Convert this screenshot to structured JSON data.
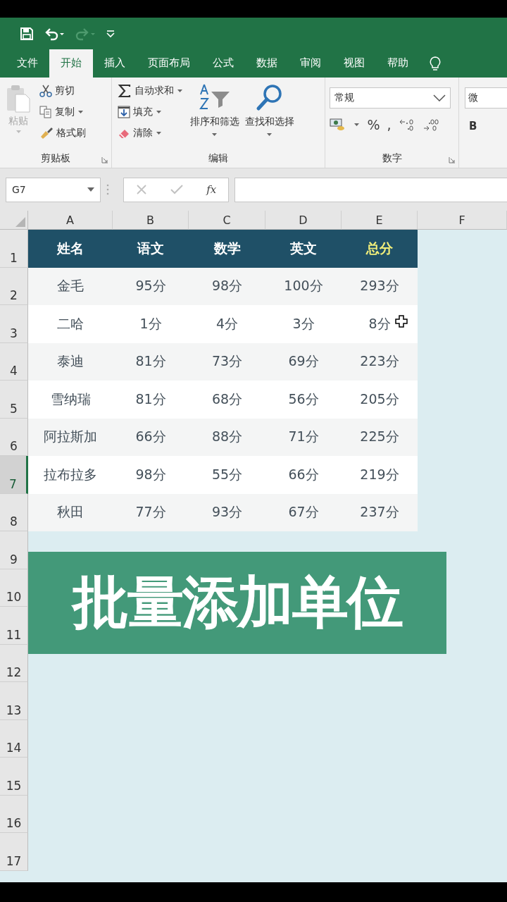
{
  "quick_access": [
    {
      "kind": "save",
      "disabled": false
    },
    {
      "kind": "undo",
      "disabled": false
    },
    {
      "kind": "redo",
      "disabled": true
    },
    {
      "kind": "customize",
      "disabled": false
    }
  ],
  "tabs": [
    {
      "label": "文件",
      "selected": false
    },
    {
      "label": "开始",
      "selected": true
    },
    {
      "label": "插入",
      "selected": false
    },
    {
      "label": "页面布局",
      "selected": false
    },
    {
      "label": "公式",
      "selected": false
    },
    {
      "label": "数据",
      "selected": false
    },
    {
      "label": "审阅",
      "selected": false
    },
    {
      "label": "视图",
      "selected": false
    },
    {
      "label": "帮助",
      "selected": false
    }
  ],
  "ribbon": {
    "clipboard": {
      "label": "剪贴板",
      "paste": {
        "label": "粘贴",
        "disabled": true
      },
      "items": [
        {
          "kind": "cut",
          "label": "剪切",
          "dropdown": false
        },
        {
          "kind": "copy",
          "label": "复制",
          "dropdown": true
        },
        {
          "kind": "format-painter",
          "label": "格式刷",
          "dropdown": false
        }
      ]
    },
    "editing": {
      "label": "编辑",
      "items": [
        {
          "kind": "autosum",
          "label": "自动求和"
        },
        {
          "kind": "fill",
          "label": "填充"
        },
        {
          "kind": "clear",
          "label": "清除"
        }
      ],
      "large": [
        {
          "kind": "sort",
          "label": "排序和筛选"
        },
        {
          "kind": "find",
          "label": "查找和选择"
        }
      ]
    },
    "number": {
      "label": "数字",
      "format": "常规",
      "symbols": [
        "%",
        ","
      ]
    },
    "font": {
      "font_name": "微",
      "bold": "B"
    }
  },
  "formula_bar": {
    "name_box": "G7",
    "fx": "fx"
  },
  "sheet": {
    "columns": [
      "A",
      "B",
      "C",
      "D",
      "E",
      "F"
    ],
    "rows": [
      {
        "label": "1",
        "selected": false
      },
      {
        "label": "2",
        "selected": false
      },
      {
        "label": "3",
        "selected": false
      },
      {
        "label": "4",
        "selected": false
      },
      {
        "label": "5",
        "selected": false
      },
      {
        "label": "6",
        "selected": false
      },
      {
        "label": "7",
        "selected": true
      },
      {
        "label": "8",
        "selected": false
      },
      {
        "label": "9",
        "selected": false
      },
      {
        "label": "10",
        "selected": false
      },
      {
        "label": "11",
        "selected": false
      },
      {
        "label": "12",
        "selected": false
      },
      {
        "label": "13",
        "selected": false
      },
      {
        "label": "14",
        "selected": false
      },
      {
        "label": "15",
        "selected": false
      },
      {
        "label": "16",
        "selected": false
      },
      {
        "label": "17",
        "selected": false
      }
    ],
    "table": {
      "header": [
        {
          "text": "姓名",
          "highlight": false
        },
        {
          "text": "语文",
          "highlight": false
        },
        {
          "text": "数学",
          "highlight": false
        },
        {
          "text": "英文",
          "highlight": false
        },
        {
          "text": "总分",
          "highlight": true
        }
      ],
      "rows": [
        [
          "金毛",
          "95分",
          "98分",
          "100分",
          "293分"
        ],
        [
          "二哈",
          "1分",
          "4分",
          "3分",
          "8分"
        ],
        [
          "泰迪",
          "81分",
          "73分",
          "69分",
          "223分"
        ],
        [
          "雪纳瑞",
          "81分",
          "68分",
          "56分",
          "205分"
        ],
        [
          "阿拉斯加",
          "66分",
          "88分",
          "71分",
          "225分"
        ],
        [
          "拉布拉多",
          "98分",
          "55分",
          "66分",
          "219分"
        ],
        [
          "秋田",
          "77分",
          "93分",
          "67分",
          "237分"
        ]
      ]
    },
    "banner": "批量添加单位"
  }
}
